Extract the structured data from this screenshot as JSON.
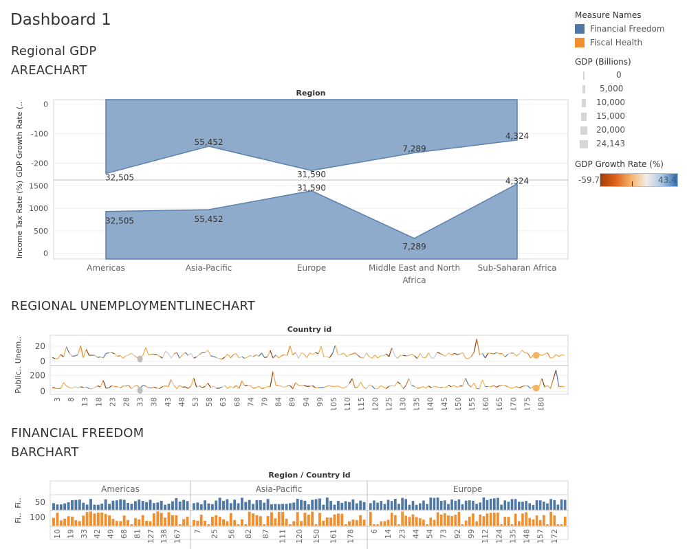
{
  "dashboard": {
    "title": "Dashboard 1"
  },
  "sections": {
    "gdp": {
      "line1": "Regional GDP",
      "line2": "AREACHART"
    },
    "unemp": {
      "line1": "REGIONAL UNEMPLOYMENTLINECHART"
    },
    "ff": {
      "line1": "FINANCIAL  FREEDOM",
      "line2": "BARCHART"
    }
  },
  "legend": {
    "measure_names": {
      "title": "Measure Names",
      "items": [
        {
          "label": "Financial Freedom",
          "color": "#4e79a7"
        },
        {
          "label": "Fiscal Health",
          "color": "#f28e2b"
        }
      ]
    },
    "size": {
      "title": "GDP (Billions)",
      "items": [
        "0",
        "5,000",
        "10,000",
        "15,000",
        "20,000",
        "24,143"
      ]
    },
    "color": {
      "title": "GDP Growth Rate (%)",
      "min": "-59.7",
      "max": "43.4"
    }
  },
  "chart_data": [
    {
      "type": "area",
      "name": "gdp-area",
      "title": "Region",
      "categories": [
        "Americas",
        "Asia-Pacific",
        "Europe",
        "Middle East and North Africa",
        "Sub-Saharan Africa"
      ],
      "category_lines": [
        [
          "Americas"
        ],
        [
          "Asia-Pacific"
        ],
        [
          "Europe"
        ],
        [
          "Middle East and North",
          "Africa"
        ],
        [
          "Sub-Saharan Africa"
        ]
      ],
      "panels": [
        {
          "ylabel": "GDP Growth Rate (..",
          "ylim": [
            -250,
            10
          ],
          "ticks": [
            "0",
            "-100",
            "-200"
          ],
          "tick_values": [
            0,
            -100,
            -200
          ],
          "values": [
            -235,
            -143,
            -225,
            -165,
            -122
          ],
          "labels": [
            "32,505",
            "55,452",
            "31,590",
            "7,289",
            "4,324"
          ],
          "reversed": true
        },
        {
          "ylabel": "Income Tax Rate (%)",
          "ylim": [
            -100,
            1600
          ],
          "ticks": [
            "1500",
            "1000",
            "500",
            "0"
          ],
          "tick_values": [
            1500,
            1000,
            500,
            0
          ],
          "values": [
            930,
            970,
            1390,
            330,
            1545
          ],
          "labels": [
            "32,505",
            "55,452",
            "31,590",
            "7,289",
            "4,324"
          ]
        }
      ],
      "color": "#7f9fc4"
    },
    {
      "type": "line",
      "name": "unemployment-line",
      "title": "Country id",
      "x_ticks": [
        "3",
        "8",
        "13",
        "18",
        "23",
        "28",
        "33",
        "38",
        "43",
        "48",
        "53",
        "58",
        "63",
        "68",
        "74",
        "79",
        "84",
        "89",
        "94",
        "99",
        "105",
        "110",
        "115",
        "120",
        "125",
        "130",
        "135",
        "140",
        "145",
        "150",
        "155",
        "160",
        "165",
        "170",
        "175",
        "180"
      ],
      "panels": [
        {
          "ylabel": "Unem..",
          "ticks": [
            "20",
            "0"
          ],
          "tick_values": [
            20,
            0
          ],
          "ylim": [
            -2,
            32
          ]
        },
        {
          "ylabel": "Public..",
          "ticks": [
            "200",
            "0"
          ],
          "tick_values": [
            200,
            0
          ],
          "ylim": [
            -15,
            300
          ]
        }
      ]
    },
    {
      "type": "bar",
      "name": "financial-freedom-bar",
      "title": "Region  /  Country id",
      "groups": [
        {
          "name": "Americas",
          "ticks": [
            "10",
            "19",
            "33",
            "42",
            "49",
            "68",
            "81",
            "127",
            "138",
            "167"
          ]
        },
        {
          "name": "Asia-Pacific",
          "ticks": [
            "7",
            "25",
            "56",
            "82",
            "87",
            "111",
            "120",
            "150",
            "161",
            "178"
          ]
        },
        {
          "name": "Europe",
          "ticks": [
            "6",
            "14",
            "23",
            "44",
            "54",
            "73",
            "92",
            "99",
            "112",
            "124",
            "135",
            "148",
            "157",
            "172"
          ]
        }
      ],
      "panels": [
        {
          "ylabel": "Fi..",
          "ticks": [
            "50"
          ],
          "color": "#4e79a7"
        },
        {
          "ylabel": "Fi..",
          "ticks": [
            "100"
          ],
          "color": "#f28e2b"
        }
      ]
    }
  ]
}
